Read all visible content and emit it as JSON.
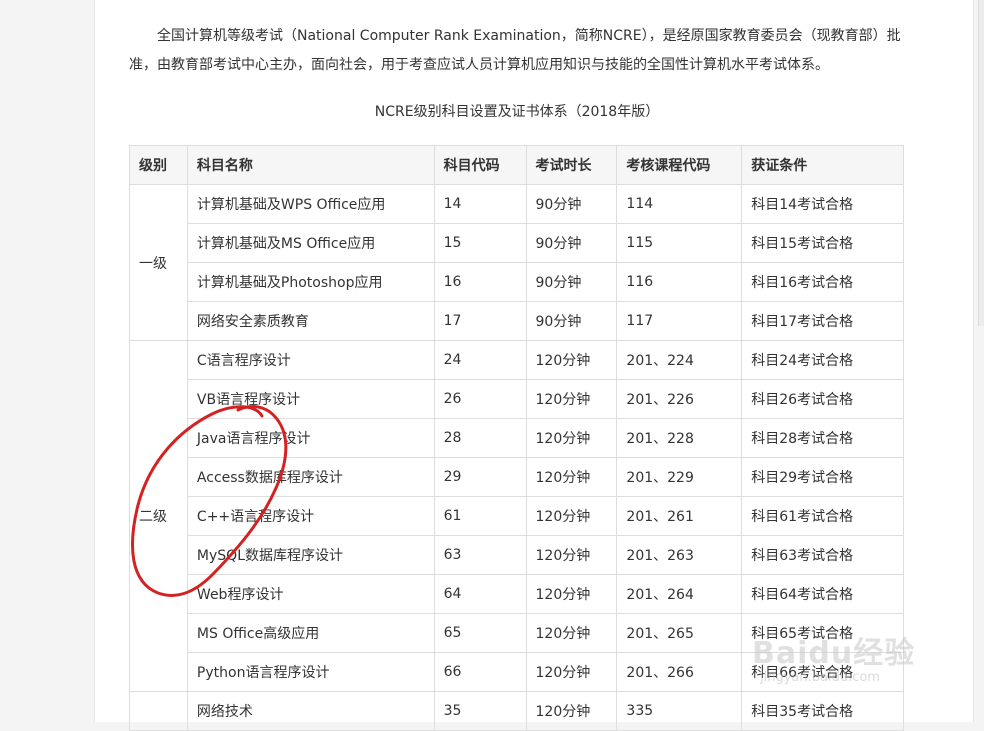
{
  "intro": "全国计算机等级考试（National Computer Rank Examination，简称NCRE），是经原国家教育委员会（现教育部）批准，由教育部考试中心主办，面向社会，用于考查应试人员计算机应用知识与技能的全国性计算机水平考试体系。",
  "caption": "NCRE级别科目设置及证书体系（2018年版）",
  "table": {
    "headers": [
      "级别",
      "科目名称",
      "科目代码",
      "考试时长",
      "考核课程代码",
      "获证条件"
    ],
    "groups": [
      {
        "level": "一级",
        "rows": [
          [
            "计算机基础及WPS Office应用",
            "14",
            "90分钟",
            "114",
            "科目14考试合格"
          ],
          [
            "计算机基础及MS Office应用",
            "15",
            "90分钟",
            "115",
            "科目15考试合格"
          ],
          [
            "计算机基础及Photoshop应用",
            "16",
            "90分钟",
            "116",
            "科目16考试合格"
          ],
          [
            "网络安全素质教育",
            "17",
            "90分钟",
            "117",
            "科目17考试合格"
          ]
        ]
      },
      {
        "level": "二级",
        "rows": [
          [
            "C语言程序设计",
            "24",
            "120分钟",
            "201、224",
            "科目24考试合格"
          ],
          [
            "VB语言程序设计",
            "26",
            "120分钟",
            "201、226",
            "科目26考试合格"
          ],
          [
            "Java语言程序设计",
            "28",
            "120分钟",
            "201、228",
            "科目28考试合格"
          ],
          [
            "Access数据库程序设计",
            "29",
            "120分钟",
            "201、229",
            "科目29考试合格"
          ],
          [
            "C++语言程序设计",
            "61",
            "120分钟",
            "201、261",
            "科目61考试合格"
          ],
          [
            "MySQL数据库程序设计",
            "63",
            "120分钟",
            "201、263",
            "科目63考试合格"
          ],
          [
            "Web程序设计",
            "64",
            "120分钟",
            "201、264",
            "科目64考试合格"
          ],
          [
            "MS Office高级应用",
            "65",
            "120分钟",
            "201、265",
            "科目65考试合格"
          ],
          [
            "Python语言程序设计",
            "66",
            "120分钟",
            "201、266",
            "科目66考试合格"
          ]
        ]
      },
      {
        "level": "",
        "rows": [
          [
            "网络技术",
            "35",
            "120分钟",
            "335",
            "科目35考试合格"
          ]
        ]
      }
    ]
  },
  "watermark": {
    "main": "Baidu经验",
    "sub": "jingyan.baidu.com"
  },
  "colors": {
    "annotation": "#d42222",
    "border": "#dddddd",
    "header_bg": "#f6f6f6"
  }
}
